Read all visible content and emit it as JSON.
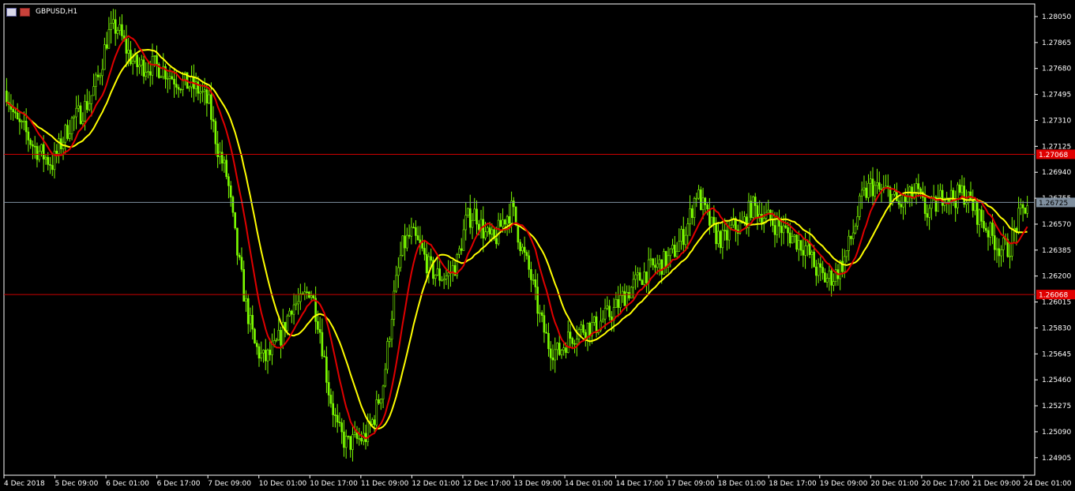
{
  "window": {
    "title": "GBPUSD,H1"
  },
  "colors": {
    "background": "#000000",
    "candle": "#7CFC00",
    "ma_fast": "#E00000",
    "ma_slow": "#FFFF00",
    "level_line": "#CC0000",
    "current_line": "#8090A0",
    "axis": "#FFFFFF"
  },
  "chart_data": {
    "type": "candlestick",
    "symbol": "GBPUSD",
    "timeframe": "H1",
    "ylim": [
      1.2478,
      1.2814
    ],
    "y_ticks": [
      "1.28050",
      "1.27865",
      "1.27680",
      "1.27495",
      "1.27310",
      "1.27125",
      "1.26940",
      "1.26755",
      "1.26570",
      "1.26385",
      "1.26200",
      "1.26015",
      "1.25830",
      "1.25645",
      "1.25460",
      "1.25275",
      "1.25090",
      "1.24905"
    ],
    "x_ticks": [
      "4 Dec 2018",
      "5 Dec 09:00",
      "6 Dec 01:00",
      "6 Dec 17:00",
      "7 Dec 09:00",
      "10 Dec 01:00",
      "10 Dec 17:00",
      "11 Dec 09:00",
      "12 Dec 01:00",
      "12 Dec 17:00",
      "13 Dec 09:00",
      "14 Dec 01:00",
      "14 Dec 17:00",
      "17 Dec 09:00",
      "18 Dec 01:00",
      "18 Dec 17:00",
      "19 Dec 09:00",
      "20 Dec 01:00",
      "20 Dec 17:00",
      "21 Dec 09:00",
      "24 Dec 01:00"
    ],
    "price_path": [
      [
        1.2752,
        1.273,
        1.2723,
        1.2712,
        1.2706,
        1.27,
        1.2716,
        1.273,
        1.2736,
        1.2745,
        1.2762,
        1.2792,
        1.2798,
        1.2782,
        1.277,
        1.277
      ],
      [
        1.277,
        1.2768,
        1.2762,
        1.2758,
        1.2756,
        1.2752,
        1.2742,
        1.271,
        1.269,
        1.264,
        1.26,
        1.257,
        1.256,
        1.2566,
        1.258,
        1.26
      ],
      [
        1.26,
        1.2612,
        1.2585,
        1.254,
        1.251,
        1.25,
        1.2503,
        1.2505,
        1.252,
        1.2545,
        1.26,
        1.264,
        1.265,
        1.264,
        1.2625,
        1.262
      ],
      [
        1.262,
        1.263,
        1.266,
        1.2665,
        1.265,
        1.2644,
        1.266,
        1.2668,
        1.264,
        1.262,
        1.259,
        1.257,
        1.2565,
        1.2575,
        1.258,
        1.2584
      ],
      [
        1.2584,
        1.259,
        1.2595,
        1.2605,
        1.2612,
        1.262,
        1.2625,
        1.2628,
        1.2632,
        1.2642,
        1.2655,
        1.268,
        1.2665,
        1.265,
        1.2645,
        1.2655
      ],
      [
        1.2655,
        1.267,
        1.2665,
        1.266,
        1.2655,
        1.265,
        1.2645,
        1.264,
        1.2625,
        1.2618,
        1.262,
        1.263,
        1.265,
        1.2675,
        1.2685,
        1.268
      ],
      [
        1.268,
        1.267,
        1.2675,
        1.268,
        1.2665,
        1.267,
        1.268,
        1.2675,
        1.268,
        1.267,
        1.266,
        1.265,
        1.264,
        1.264,
        1.266,
        1.2672
      ]
    ],
    "series": [
      {
        "type": "moving_average",
        "color": "red",
        "period": 10
      },
      {
        "type": "moving_average",
        "color": "yellow",
        "period": 20
      }
    ],
    "levels": [
      {
        "label": "1.27068",
        "value": 1.27068,
        "color": "red"
      },
      {
        "label": "1.26068",
        "value": 1.26068,
        "color": "red"
      }
    ],
    "current_price": {
      "label": "1.26725",
      "value": 1.26725
    },
    "grid": false
  }
}
